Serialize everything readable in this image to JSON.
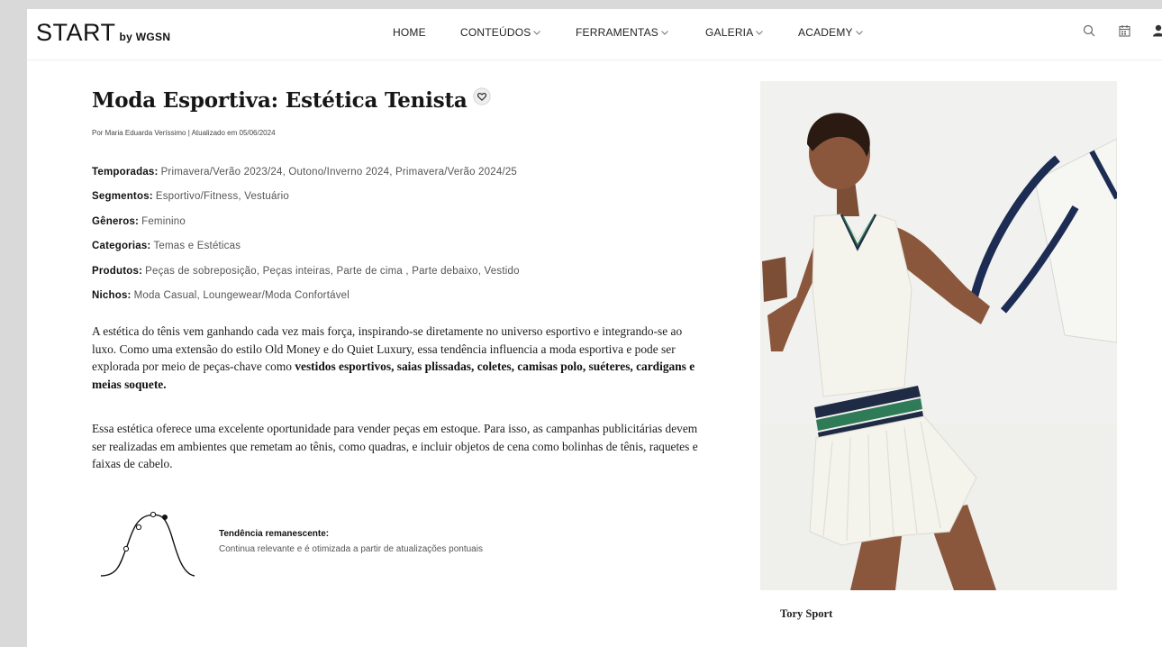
{
  "header": {
    "logo_main": "START",
    "logo_sub": "by WGSN",
    "nav": [
      {
        "label": "HOME"
      },
      {
        "label": "CONTEÚDOS"
      },
      {
        "label": "FERRAMENTAS"
      },
      {
        "label": "GALERIA"
      },
      {
        "label": "ACADEMY"
      }
    ],
    "icons": [
      "search-icon",
      "calendar-icon",
      "user-icon"
    ]
  },
  "article": {
    "title": "Moda Esportiva: Estética Tenista",
    "byline": "Por Maria Eduarda Veríssimo | Atualizado em 05/06/2024",
    "meta": [
      {
        "label": "Temporadas:",
        "value": "Primavera/Verão 2023/24,  Outono/Inverno 2024,  Primavera/Verão 2024/25"
      },
      {
        "label": "Segmentos:",
        "value": "Esportivo/Fitness,  Vestuário"
      },
      {
        "label": "Gêneros:",
        "value": "Feminino"
      },
      {
        "label": "Categorias:",
        "value": "Temas e Estéticas"
      },
      {
        "label": "Produtos:",
        "value": "Peças de sobreposição,  Peças inteiras,  Parte de cima ,  Parte debaixo,  Vestido"
      },
      {
        "label": "Nichos:",
        "value": "Moda Casual,  Loungewear/Moda Confortável"
      }
    ],
    "para1_text": "A estética do tênis vem ganhando cada vez mais força, inspirando-se diretamente no universo esportivo e integrando-se ao luxo. Como uma extensão do estilo Old Money e do Quiet Luxury, essa tendência influencia a moda esportiva e pode ser explorada por meio de peças-chave como ",
    "para1_bold": "vestidos esportivos, saias plissadas, coletes, camisas polo, suéteres, cardigans e meias soquete.",
    "para2": "Essa estética oferece uma excelente oportunidade para vender peças em estoque. Para isso, as campanhas publicitárias devem ser realizadas em ambientes que remetam ao tênis, como quadras, e incluir objetos de cena como bolinhas de tênis, raquetes e faixas de cabelo.",
    "trend_title": "Tendência remanescente:",
    "trend_desc": "Continua relevante e é otimizada a partir de atualizações pontuais",
    "caption": "Tory Sport"
  },
  "colors": {
    "dress": "#f4f3ec",
    "stripe_navy": "#1f2a44",
    "stripe_green": "#2f7a57",
    "skin": "#8a573c",
    "bag_strap": "#1d2c53",
    "photo_bg": "#f1f1ef"
  }
}
